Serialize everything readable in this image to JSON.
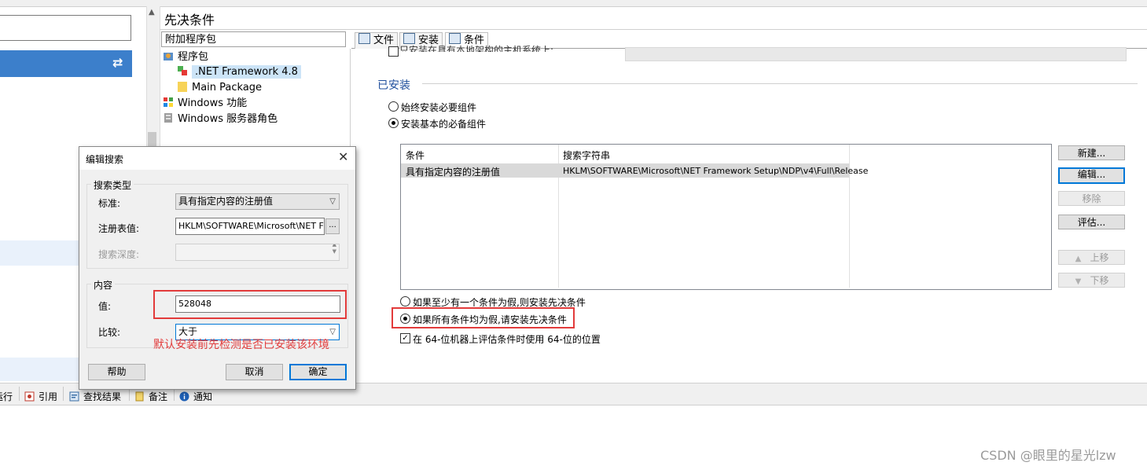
{
  "main": {
    "title": "先决条件"
  },
  "tree": {
    "header": "附加程序包",
    "items": [
      {
        "label": "程序包",
        "icon": "package-icon"
      },
      {
        "label": ".NET Framework 4.8",
        "icon": "dotnet-package-icon"
      },
      {
        "label": "Main Package",
        "icon": "folder-icon"
      },
      {
        "label": "Windows 功能",
        "icon": "windows-features-icon"
      },
      {
        "label": "Windows 服务器角色",
        "icon": "server-role-icon"
      }
    ]
  },
  "tabs": [
    {
      "label": "文件",
      "icon": "file-icon"
    },
    {
      "label": "安装",
      "icon": "install-icon"
    },
    {
      "label": "条件",
      "icon": "condition-icon"
    }
  ],
  "installed": {
    "cut_off_text": "只安装在具有本地架构的主机系统上:",
    "group_label": "已安装",
    "radio_always": "始终安装必要组件",
    "radio_basic": "安装基本的必备组件",
    "conditions": {
      "columns": [
        "条件",
        "搜索字符串"
      ],
      "rows": [
        {
          "condition": "具有指定内容的注册值",
          "search": "HKLM\\SOFTWARE\\Microsoft\\NET Framework Setup\\NDP\\v4\\Full\\Release"
        }
      ]
    },
    "buttons": {
      "new": "新建...",
      "edit": "编辑...",
      "remove": "移除",
      "evaluate": "评估...",
      "move_up": "上移",
      "move_down": "下移"
    },
    "radio_any_false": "如果至少有一个条件为假,则安装先决条件",
    "radio_all_false": "如果所有条件均为假,请安装先决条件",
    "check_64bit": "在 64-位机器上评估条件时使用 64-位的位置"
  },
  "bottom_bar": {
    "items": [
      {
        "label": "运行",
        "icon": "run-icon"
      },
      {
        "label": "引用",
        "icon": "reference-icon"
      },
      {
        "label": "查找结果",
        "icon": "find-results-icon"
      },
      {
        "label": "备注",
        "icon": "notes-icon"
      },
      {
        "label": "通知",
        "icon": "info-icon"
      }
    ]
  },
  "dialog": {
    "title": "编辑搜索",
    "search_type_group": "搜索类型",
    "criteria_label": "标准:",
    "criteria_value": "具有指定内容的注册值",
    "registry_label": "注册表值:",
    "registry_value": "HKLM\\SOFTWARE\\Microsoft\\NET Fram",
    "browse": "...",
    "depth_label": "搜索深度:",
    "content_group": "内容",
    "value_label": "值:",
    "value": "528048",
    "compare_label": "比较:",
    "compare_value": "大于",
    "help": "帮助",
    "cancel": "取消",
    "ok": "确定"
  },
  "annotation": "默认安装前先检测是否已安装该环境",
  "watermark": "CSDN @眼里的星光lzw",
  "colors": {
    "accent_blue": "#3c7fcb",
    "highlight_red": "#e23b3b",
    "group_label_blue": "#1e4e9c"
  }
}
